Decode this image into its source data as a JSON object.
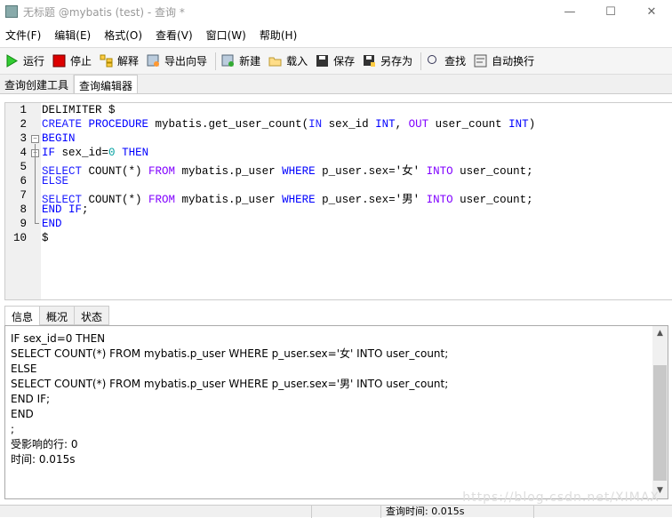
{
  "window": {
    "title": "无标题 @mybatis (test) - 查询 *",
    "minimize": "—",
    "maximize": "☐",
    "close": "✕"
  },
  "menu": [
    "文件(F)",
    "编辑(E)",
    "格式(O)",
    "查看(V)",
    "窗口(W)",
    "帮助(H)"
  ],
  "toolbar": [
    {
      "label": "运行",
      "icon": "run-icon"
    },
    {
      "label": "停止",
      "icon": "stop-icon"
    },
    {
      "label": "解释",
      "icon": "explain-icon"
    },
    {
      "label": "导出向导",
      "icon": "export-wizard-icon"
    },
    {
      "label": "新建",
      "icon": "new-icon"
    },
    {
      "label": "载入",
      "icon": "folder-open-icon"
    },
    {
      "label": "保存",
      "icon": "save-icon"
    },
    {
      "label": "另存为",
      "icon": "save-as-icon"
    },
    {
      "label": "查找",
      "icon": "search-icon"
    },
    {
      "label": "自动换行",
      "icon": "word-wrap-icon"
    }
  ],
  "top_tabs": [
    "查询创建工具",
    "查询编辑器"
  ],
  "editor": {
    "line_numbers": [
      "1",
      "2",
      "3",
      "4",
      "5",
      "6",
      "7",
      "8",
      "9",
      "10"
    ],
    "lines": [
      [
        [
          "DELIMITER $",
          "s"
        ]
      ],
      [
        [
          "CREATE",
          "k2"
        ],
        [
          " ",
          "s"
        ],
        [
          "PROCEDURE",
          "k"
        ],
        [
          " mybatis.get_user_count(",
          "s"
        ],
        [
          "IN",
          "k2"
        ],
        [
          " sex_id ",
          "s"
        ],
        [
          "INT",
          "k"
        ],
        [
          ", ",
          "s"
        ],
        [
          "OUT",
          "f"
        ],
        [
          " user_count ",
          "s"
        ],
        [
          "INT",
          "k"
        ],
        [
          ")",
          "s"
        ]
      ],
      [
        [
          "BEGIN",
          "k"
        ]
      ],
      [
        [
          "IF",
          "k"
        ],
        [
          " sex_id=",
          "s"
        ],
        [
          "0",
          "n"
        ],
        [
          " ",
          "s"
        ],
        [
          "THEN",
          "k"
        ]
      ],
      [
        [
          "SELECT",
          "k2"
        ],
        [
          " COUNT(*) ",
          "s"
        ],
        [
          "FROM",
          "f"
        ],
        [
          " mybatis.p_user ",
          "s"
        ],
        [
          "WHERE",
          "k"
        ],
        [
          " p_user.sex='女' ",
          "s"
        ],
        [
          "INTO",
          "f"
        ],
        [
          " user_count;",
          "s"
        ]
      ],
      [
        [
          "ELSE",
          "k2"
        ]
      ],
      [
        [
          "SELECT",
          "k2"
        ],
        [
          " COUNT(*) ",
          "s"
        ],
        [
          "FROM",
          "f"
        ],
        [
          " mybatis.p_user ",
          "s"
        ],
        [
          "WHERE",
          "k"
        ],
        [
          " p_user.sex='男' ",
          "s"
        ],
        [
          "INTO",
          "f"
        ],
        [
          " user_count;",
          "s"
        ]
      ],
      [
        [
          "END IF",
          "k"
        ],
        [
          ";",
          "s"
        ]
      ],
      [
        [
          "END",
          "k"
        ]
      ],
      [
        [
          "$",
          "s"
        ]
      ]
    ]
  },
  "bottom_tabs": [
    "信息",
    "概况",
    "状态"
  ],
  "messages": [
    "IF sex_id=0 THEN",
    "SELECT COUNT(*) FROM mybatis.p_user WHERE p_user.sex='女' INTO user_count;",
    "ELSE",
    "SELECT COUNT(*) FROM mybatis.p_user WHERE p_user.sex='男' INTO user_count;",
    "END IF;",
    "END",
    ";",
    "受影响的行: 0",
    "时间: 0.015s"
  ],
  "status": {
    "query_time": "查询时间: 0.015s"
  },
  "watermark": "https://blog.csdn.net/XIMAX"
}
